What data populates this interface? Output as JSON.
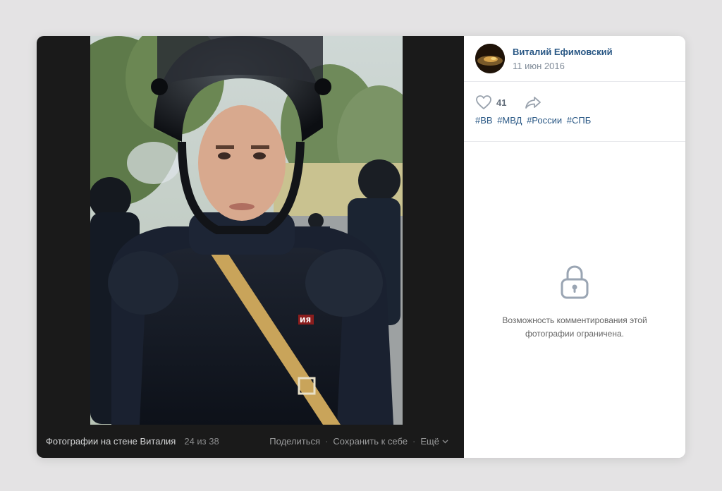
{
  "photo_footer": {
    "album_title": "Фотографии на стене Виталия",
    "counter": "24 из 38",
    "share_label": "Поделиться",
    "save_label": "Сохранить к себе",
    "more_label": "Ещё",
    "separator": "·"
  },
  "post": {
    "author_name": "Виталий Ефимовский",
    "date": "11 июн 2016",
    "likes": "41",
    "hashtags": [
      "#ВВ",
      "#МВД",
      "#России",
      "#СПБ"
    ]
  },
  "comments": {
    "locked_line1": "Возможность комментирования этой",
    "locked_line2": "фотографии ограничена."
  },
  "photo_patch_text": "ИЯ",
  "icons": {
    "like": "heart-icon",
    "share": "share-arrow-icon",
    "lock": "lock-icon",
    "more": "chevron-down-icon"
  },
  "colors": {
    "link": "#2a5885",
    "muted": "#818c99",
    "photo_bg": "#1a1a1a"
  }
}
